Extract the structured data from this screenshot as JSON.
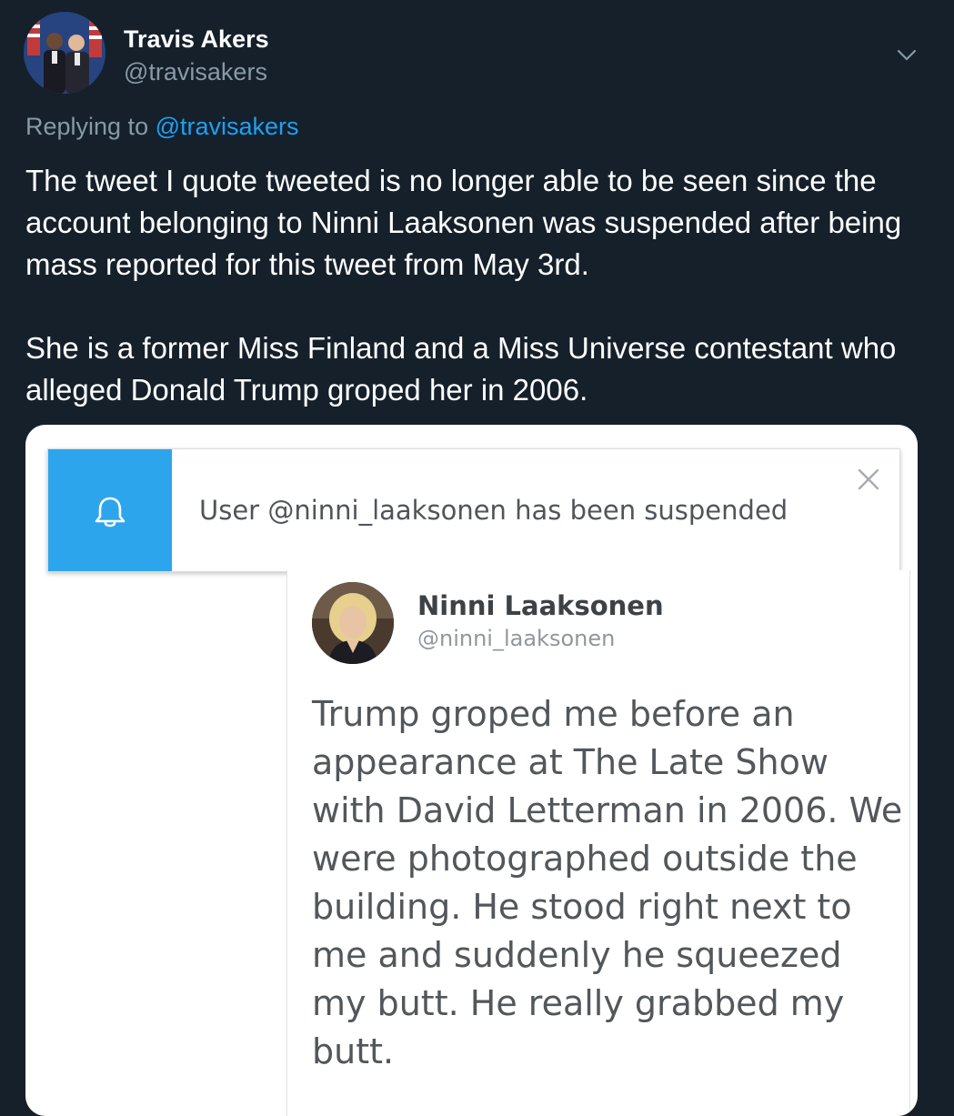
{
  "tweet": {
    "author_name": "Travis Akers",
    "author_handle": "@travisakers",
    "replying_prefix": "Replying to",
    "replying_to": "@travisakers",
    "paragraphs": [
      "The tweet I quote tweeted is no longer able to be seen since the account belonging to Ninni Laaksonen was suspended after being mass reported for this tweet from May 3rd.",
      "She is a former Miss Finland and a Miss Universe contestant who alleged Donald Trump groped her in 2006."
    ],
    "menu_icon": "chevron-down-icon"
  },
  "media": {
    "notice": {
      "icon": "bell-icon",
      "text": "User @ninni_laaksonen has been suspended",
      "close_icon": "close-icon",
      "accent_color": "#2da5ec"
    },
    "quoted_tweet": {
      "name": "Ninni Laaksonen",
      "handle": "@ninni_laaksonen",
      "lines": [
        "Trump groped me before an",
        "appearance at The Late Show",
        "with David Letterman in 2006. We",
        "were photographed outside the",
        "building. He stood right next to",
        "me and suddenly he squeezed",
        "my butt. He really grabbed my",
        "butt."
      ]
    }
  },
  "colors": {
    "background": "#15202b",
    "primary_text": "#ffffff",
    "secondary_text": "#8899a6",
    "link": "#1da1f2"
  }
}
